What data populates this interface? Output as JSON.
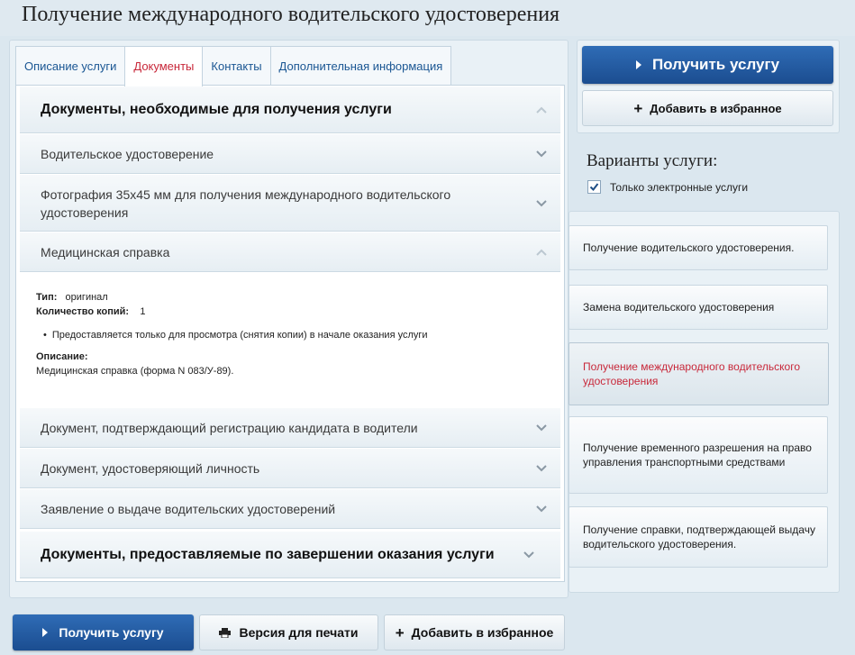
{
  "page": {
    "title": "Получение международного водительского удостоверения"
  },
  "tabs": [
    {
      "label": "Описание услуги",
      "active": false
    },
    {
      "label": "Документы",
      "active": true
    },
    {
      "label": "Контакты",
      "active": false
    },
    {
      "label": "Дополнительная информация",
      "active": false
    }
  ],
  "documents": {
    "section_required": {
      "label": "Документы, необходимые для получения услуги",
      "expanded": true
    },
    "items": [
      {
        "label": "Водительское удостоверение",
        "expanded": false
      },
      {
        "label": "Фотография 35х45 мм для получения международного водительского удостоверения",
        "expanded": false
      },
      {
        "label": "Медицинская справка",
        "expanded": true
      },
      {
        "label": "Документ, подтверждающий регистрацию кандидата в водители",
        "expanded": false
      },
      {
        "label": "Документ, удостоверяющий личность",
        "expanded": false
      },
      {
        "label": "Заявление о выдаче водительских удостоверений",
        "expanded": false
      }
    ],
    "detail": {
      "type_label": "Тип:",
      "type_value": "оригинал",
      "copies_label": "Количество копий:",
      "copies_value": "1",
      "note": "Предоставляется только для просмотра (снятия копии) в начале оказания услуги",
      "description_label": "Описание:",
      "description_value": "Медицинская справка (форма N 083/У-89)."
    },
    "section_completion": {
      "label": "Документы, предоставляемые по завершении оказания услуги",
      "expanded": false
    }
  },
  "sidebar": {
    "get_service": "Получить услугу",
    "add_favorite": "Добавить в избранное",
    "variants_title": "Варианты услуги:",
    "electronic_only_label": "Только электронные услуги",
    "electronic_only_checked": true,
    "variants": [
      {
        "label": "Получение водительского удостоверения.",
        "active": false
      },
      {
        "label": "Замена водительского удостоверения",
        "active": false
      },
      {
        "label": "Получение международного водительского удостоверения",
        "active": true
      },
      {
        "label": "Получение временного разрешения на право управления транспортными средствами",
        "active": false
      },
      {
        "label": "Получение справки, подтверждающей выдачу водительского удостоверения.",
        "active": false
      }
    ]
  },
  "bottom": {
    "get_service": "Получить услугу",
    "print_version": "Версия для печати",
    "add_favorite": "Добавить в избранное"
  },
  "colors": {
    "primary": "#1f5aa6",
    "active_text": "#c8283a",
    "link": "#1a5693"
  }
}
